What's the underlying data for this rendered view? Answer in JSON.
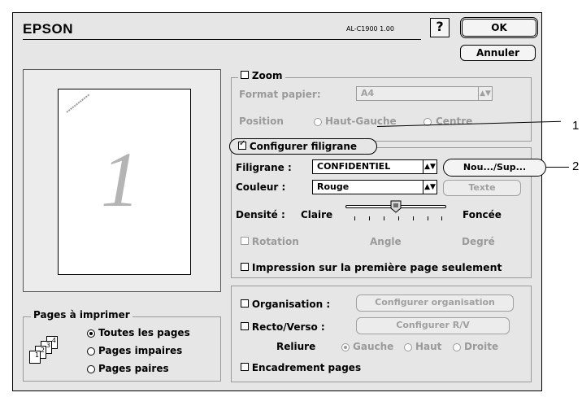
{
  "header": {
    "brand": "EPSON",
    "model": "AL-C1900  1.00",
    "help_label": "?",
    "ok_label": "OK",
    "cancel_label": "Annuler"
  },
  "preview": {
    "page_number": "1"
  },
  "zoom": {
    "label": "Zoom",
    "checked": false,
    "paper_format_label": "Format papier:",
    "paper_format_value": "A4",
    "position_label": "Position",
    "options": [
      "Haut-Gauche",
      "Centre"
    ]
  },
  "watermark": {
    "configure_label": "Configurer filigrane",
    "checked": true,
    "filigrane_label": "Filigrane :",
    "filigrane_value": "CONFIDENTIEL",
    "new_delete_button": "Nou.../Sup...",
    "color_label": "Couleur :",
    "color_value": "Rouge",
    "text_button": "Texte",
    "density_label": "Densité :",
    "density_min": "Claire",
    "density_max": "Foncée",
    "density_level": 0.5,
    "rotation_label": "Rotation",
    "angle_label": "Angle",
    "degree_label": "Degré",
    "first_page_label": "Impression sur la première page seulement"
  },
  "layout": {
    "organisation_label": "Organisation :",
    "organisation_button": "Configurer organisation",
    "duplex_label": "Recto/Verso :",
    "duplex_button": "Configurer R/V",
    "binding_label": "Reliure",
    "binding_options": [
      "Gauche",
      "Haut",
      "Droite"
    ],
    "border_label": "Encadrement pages"
  },
  "pages": {
    "title": "Pages à imprimer",
    "options": [
      "Toutes les pages",
      "Pages impaires",
      "Pages paires"
    ],
    "selected": 0,
    "icon_numbers": [
      "1",
      "2",
      "3",
      "4"
    ]
  },
  "callouts": [
    "1",
    "2"
  ]
}
